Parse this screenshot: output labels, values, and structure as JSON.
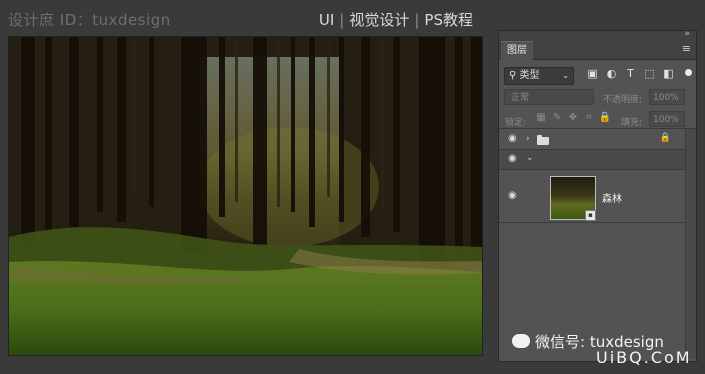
{
  "header": {
    "id_label": "设计庶 ID：tuxdesign",
    "nav_items": [
      "UI",
      "视觉设计",
      "PS教程"
    ]
  },
  "panel": {
    "tab_label": "图层",
    "filter": {
      "search_glyph": "⚲",
      "label": "类型",
      "chevron": "⌄"
    },
    "filter_icons": [
      "image-filter-icon",
      "adjustment-filter-icon",
      "text-filter-icon",
      "shape-filter-icon",
      "smart-object-filter-icon"
    ],
    "blend_mode": "正常",
    "opacity_label": "不透明度:",
    "opacity_value": "100%",
    "lock_label": "锁定:",
    "lock_icons": [
      "lock-transparent-icon",
      "lock-paint-icon",
      "lock-move-icon",
      "lock-artboard-icon",
      "lock-all-icon"
    ],
    "fill_label": "填充:",
    "fill_value": "100%",
    "layers": [
      {
        "type": "group",
        "expanded": false,
        "locked": true,
        "name": ""
      },
      {
        "type": "group",
        "expanded": true,
        "name": ""
      },
      {
        "type": "smart-object",
        "name": "森林",
        "visible": true
      }
    ]
  },
  "watermark": {
    "text": "微信号: tuxdesign"
  },
  "logo": {
    "text": "UiBQ.CoM"
  }
}
